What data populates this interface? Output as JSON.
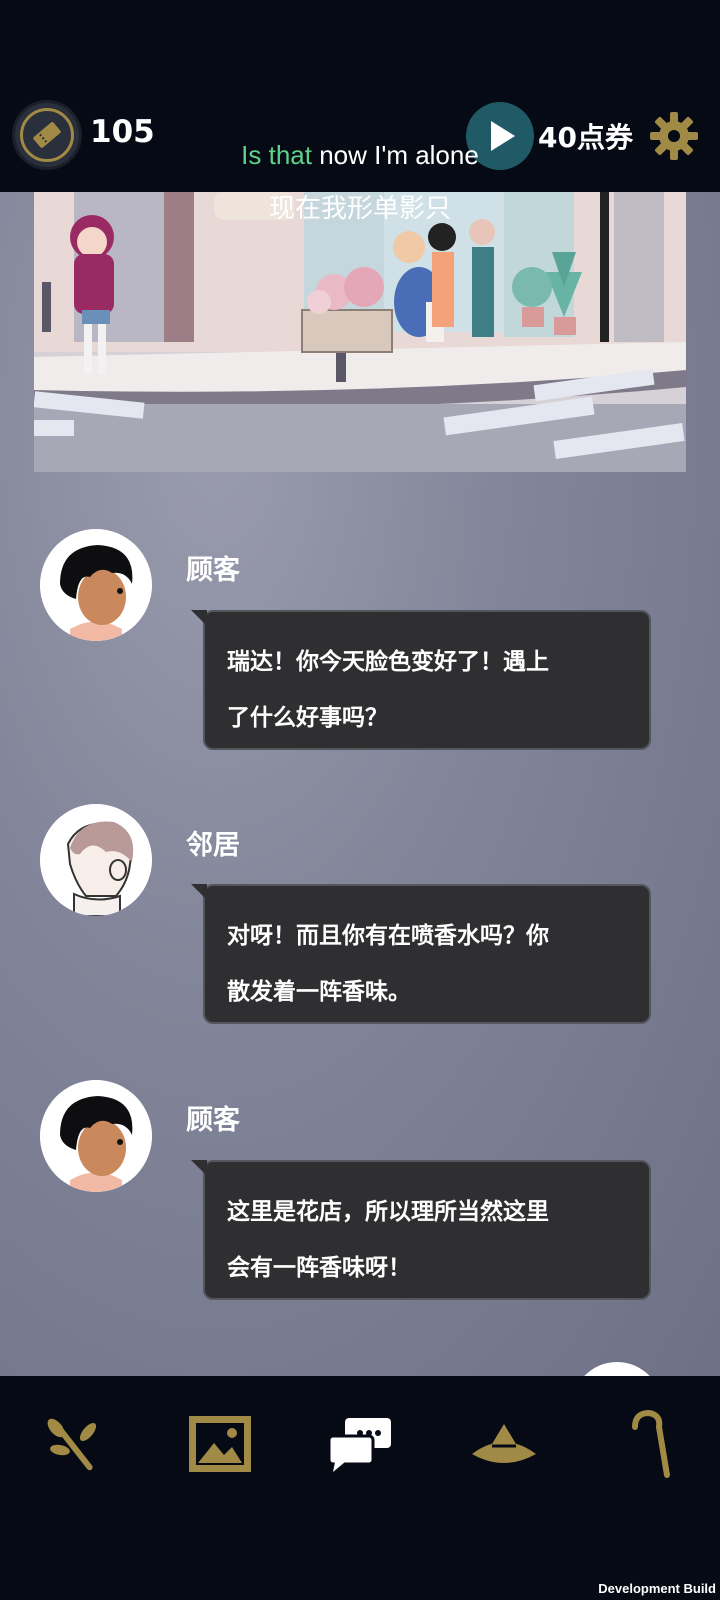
{
  "topbar": {
    "ticket_count": "105",
    "coupon_label": "40点券"
  },
  "subtitle": {
    "en_highlight": "Is that",
    "en_rest": " now I'm alone",
    "zh": "现在我形单影只"
  },
  "dialogue": [
    {
      "speaker": "顾客",
      "line1": "瑞达！你今天脸色变好了！遇上",
      "line2": "了什么好事吗？"
    },
    {
      "speaker": "邻居",
      "line1": "对呀！而且你有在喷香水吗？你",
      "line2": "散发着一阵香味。"
    },
    {
      "speaker": "顾客",
      "line1": "这里是花店，所以理所当然这里",
      "line2": "会有一阵香味呀！"
    }
  ],
  "footer": {
    "dev_build": "Development Build"
  },
  "colors": {
    "gold": "#a08a45",
    "play_bg": "#1f5a66",
    "subtitle_highlight": "#5fd18a",
    "bubble_bg": "#2f2f32"
  },
  "icons": [
    "ticket-icon",
    "play-icon",
    "gear-icon",
    "branch-icon",
    "gallery-icon",
    "chat-icon",
    "hat-icon",
    "cane-icon"
  ]
}
